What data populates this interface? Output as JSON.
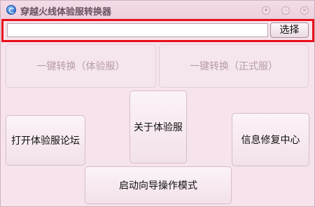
{
  "window": {
    "title": "穿越火线体验服转换器",
    "controls": [
      "▾",
      "–",
      "×"
    ]
  },
  "path_bar": {
    "input_value": "",
    "select_label": "选择"
  },
  "buttons": {
    "convert_trial": "一键转换（体验服）",
    "convert_official": "一键转换（正式服）",
    "about_trial": "关于体验服",
    "open_forum": "打开体验服论坛",
    "info_repair": "信息修复中心",
    "wizard_mode": "启动向导操作模式"
  },
  "colors": {
    "highlight_border": "#e8101c",
    "window_bg": "#f6e3ec"
  }
}
